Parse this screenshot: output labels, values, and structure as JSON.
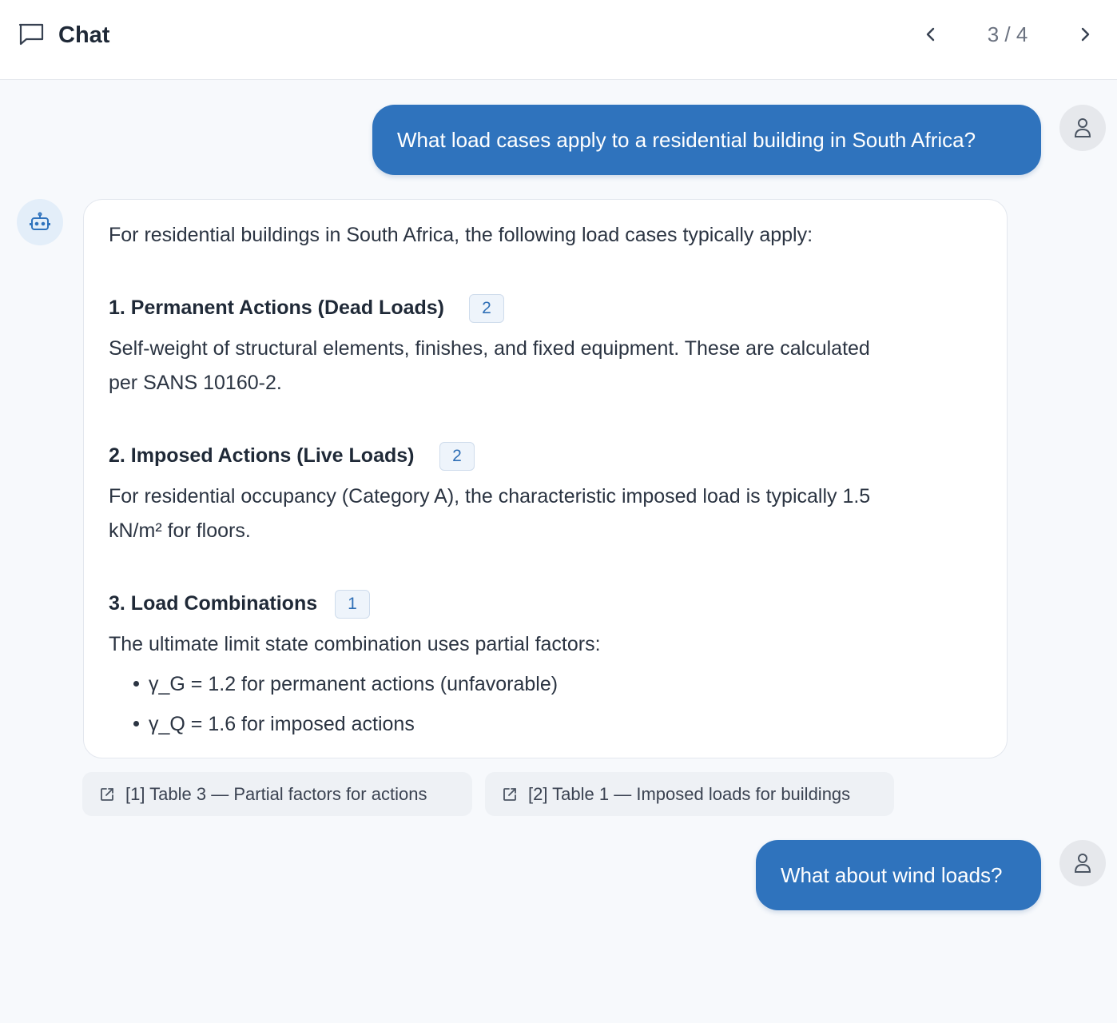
{
  "header": {
    "title": "Chat",
    "pager": "3 / 4",
    "icons": {
      "chat": "chat-bubble-icon",
      "prev": "chevron-left-icon",
      "next": "chevron-right-icon"
    }
  },
  "messages": [
    {
      "role": "user",
      "text": "What load cases apply to a residential building in South Africa?"
    },
    {
      "role": "assistant",
      "intro": "For residential buildings in South Africa, the following load cases typically apply:",
      "sections": [
        {
          "heading": "1. Permanent Actions (Dead Loads)",
          "citation": "2",
          "lines": [
            "Self-weight of structural elements, finishes, and fixed equipment. These are calculated",
            "per SANS 10160-2."
          ]
        },
        {
          "heading": "2. Imposed Actions (Live Loads)",
          "citation": "2",
          "lines": [
            "For residential occupancy (Category A), the characteristic imposed load is typically 1.5",
            "kN/m² for floors."
          ]
        },
        {
          "heading": "3. Load Combinations",
          "citation": "1",
          "lines": [
            "The ultimate limit state combination uses partial factors:"
          ],
          "bullets": [
            "γ_G = 1.2 for permanent actions (unfavorable)",
            "γ_Q = 1.6 for imposed actions"
          ]
        }
      ],
      "sources": [
        "[1] Table 3 — Partial factors for actions",
        "[2] Table 1 — Imposed loads for buildings"
      ]
    },
    {
      "role": "user",
      "text": "What about wind loads?"
    }
  ],
  "colors": {
    "accent": "#2f73bd",
    "background": "#f7f9fc",
    "badge_text": "#2f6fb6"
  }
}
